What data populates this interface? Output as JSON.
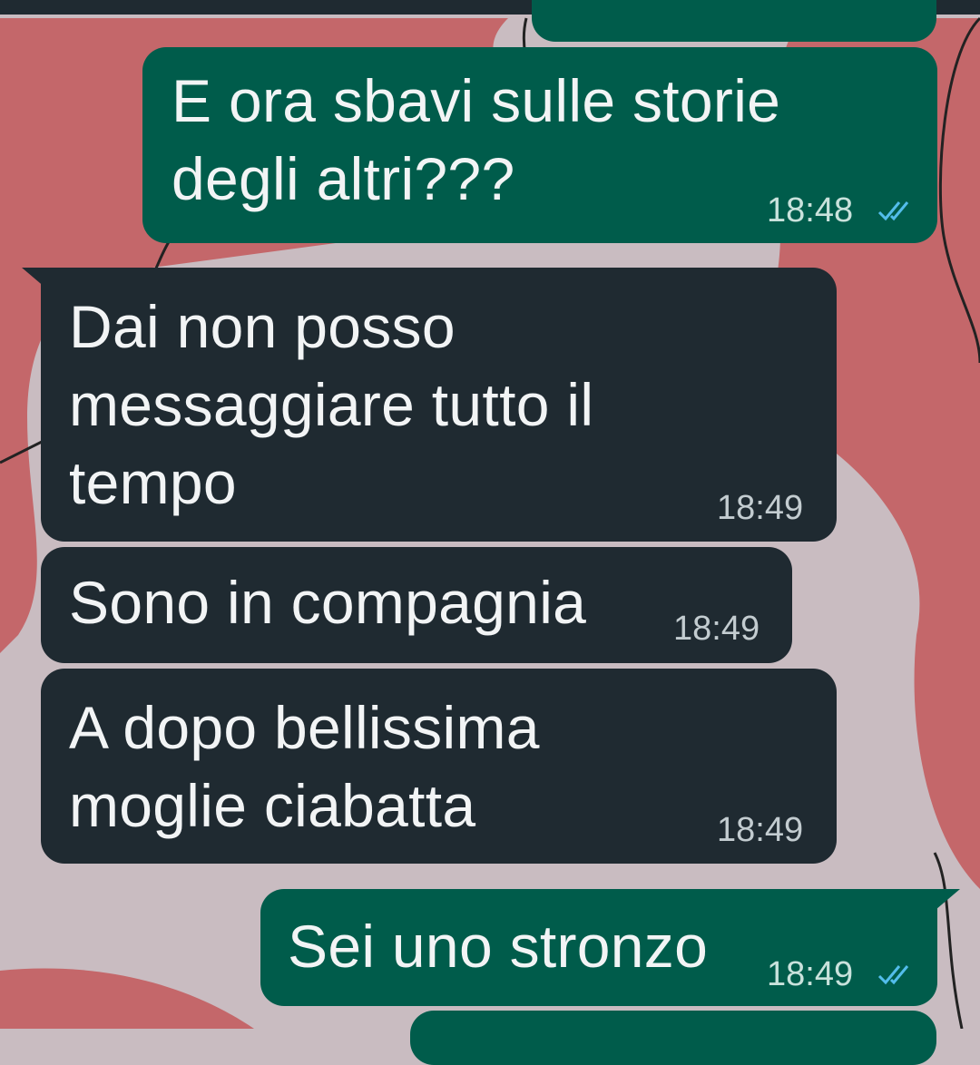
{
  "colors": {
    "outgoing_bubble": "#005c4b",
    "incoming_bubble": "#1f2a31",
    "read_ticks": "#53bdeb",
    "wallpaper_bg": "#c9bcc1",
    "wallpaper_shape": "#c4676a"
  },
  "messages": [
    {
      "direction": "outgoing",
      "text": "E ora sbavi sulle storie\ndegli altri???",
      "time": "18:48",
      "status_icon": "double-check-read-icon"
    },
    {
      "direction": "incoming",
      "text": "Dai non posso\nmessaggiare tutto il\ntempo",
      "time": "18:49"
    },
    {
      "direction": "incoming",
      "text": "Sono in compagnia",
      "time": "18:49"
    },
    {
      "direction": "incoming",
      "text": "A dopo bellissima\nmoglie ciabatta",
      "time": "18:49"
    },
    {
      "direction": "outgoing",
      "text": "Sei uno stronzo",
      "time": "18:49",
      "status_icon": "double-check-read-icon"
    }
  ]
}
